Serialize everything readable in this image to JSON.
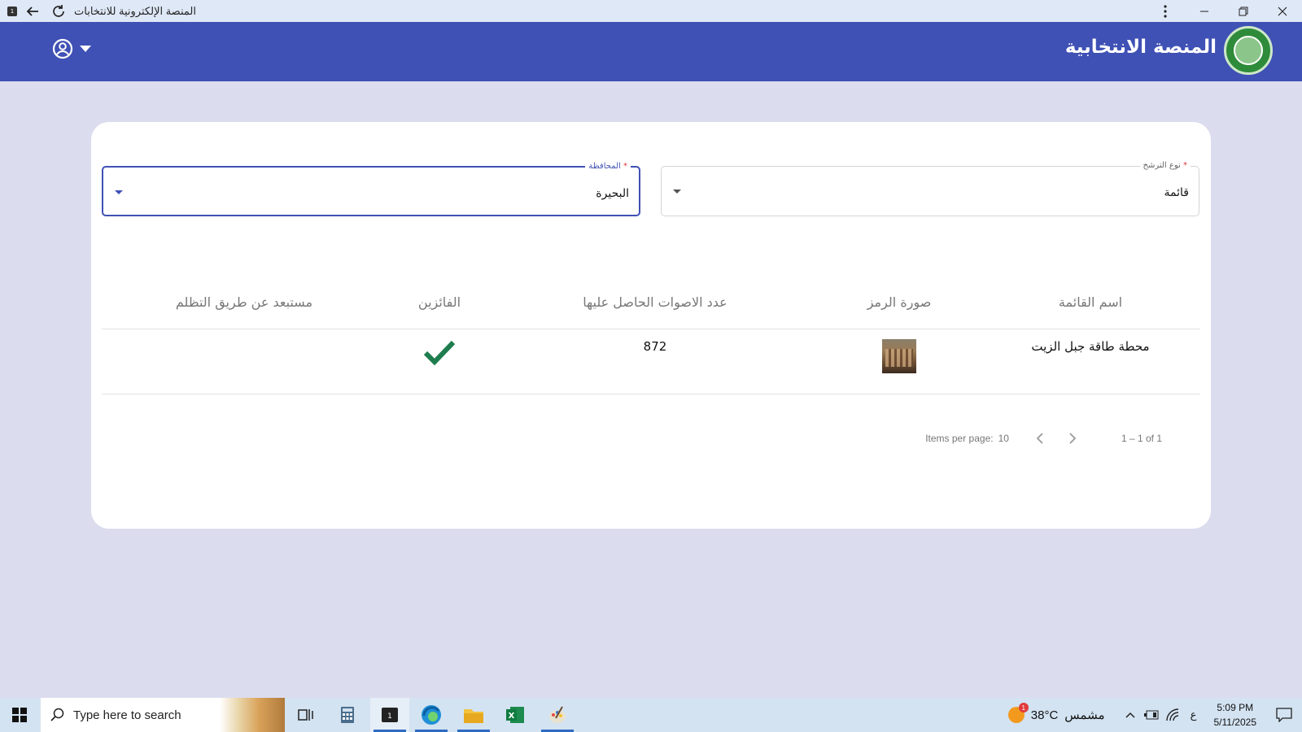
{
  "window": {
    "title": "المنصة الإلكترونية للانتخابات",
    "app_icon_text": "1"
  },
  "header": {
    "brand_title": "المنصة الانتخابية",
    "logo_icon": "election-seal-logo",
    "user_icon": "account-circle-icon",
    "menu_icon": "arrow-drop-down-icon"
  },
  "filters": {
    "governorate": {
      "label": "المحافظة",
      "required_mark": "*",
      "value": "البحيرة"
    },
    "candidacy_type": {
      "label": "نوع الترشح",
      "required_mark": "*",
      "value": "قائمة"
    }
  },
  "table": {
    "headers": {
      "list_name": "اسم القائمة",
      "symbol_image": "صورة الرمز",
      "votes": "عدد الاصوات الحاصل عليها",
      "winners": "الفائزين",
      "excluded": "مستبعد عن طريق التظلم"
    },
    "rows": [
      {
        "list_name": "محطة طاقة جبل الزيت",
        "votes": "872",
        "winner_icon": "checkmark-icon",
        "excluded": ""
      }
    ]
  },
  "paginator": {
    "items_per_page_label": "Items per page:",
    "page_size": "10",
    "range_label": "1 – 1 of 1"
  },
  "taskbar": {
    "search_placeholder": "Type here to search",
    "weather_temp": "38°C",
    "weather_text": "مشمس",
    "weather_badge": "1",
    "language": "ع",
    "time": "5:09 PM",
    "date": "5/11/2025"
  },
  "colors": {
    "primary": "#3f51b5",
    "page_bg": "#dcdcef",
    "check_green": "#1e7d4e"
  }
}
